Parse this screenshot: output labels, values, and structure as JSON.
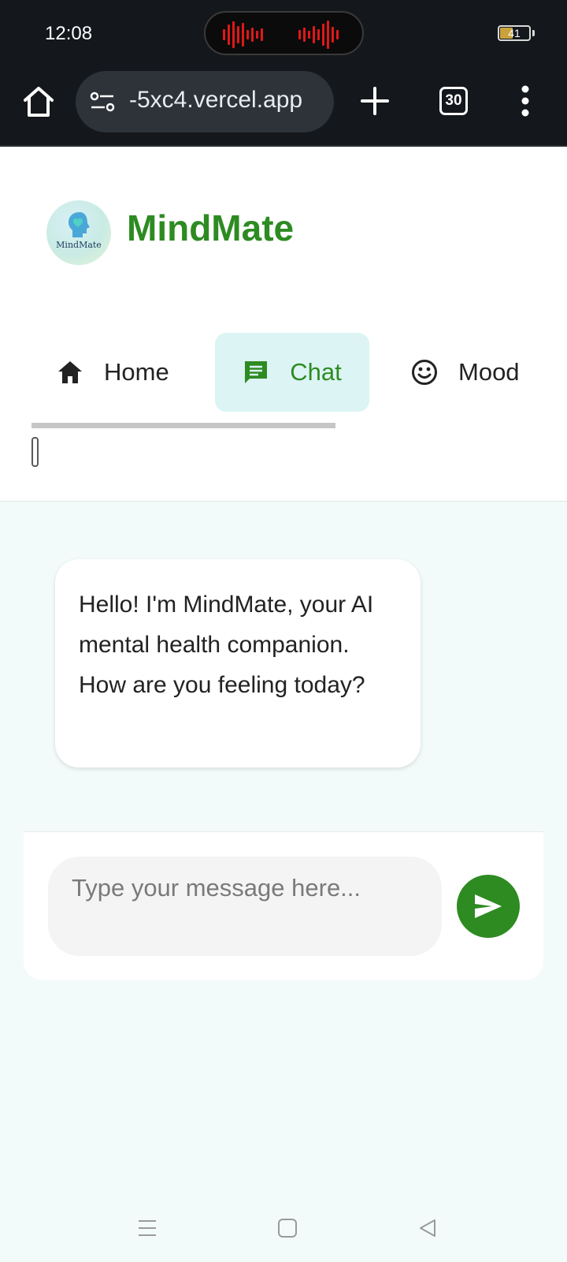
{
  "status_bar": {
    "time": "12:08",
    "battery_percent": 41,
    "battery_label": "41"
  },
  "browser": {
    "url": "-5xc4.vercel.app",
    "tab_count": "30",
    "icons": [
      "home-icon",
      "site-settings-icon",
      "new-tab-plus-icon",
      "tab-switcher-icon",
      "more-vert-icon"
    ]
  },
  "app": {
    "logo_text": "MindMate",
    "brand": "MindMate",
    "brand_color": "#2e8b22"
  },
  "nav": {
    "items": [
      {
        "label": "Home",
        "icon": "home-icon",
        "active": false
      },
      {
        "label": "Chat",
        "icon": "chat-icon",
        "active": true
      },
      {
        "label": "Mood",
        "icon": "smiley-icon",
        "active": false
      }
    ]
  },
  "chat": {
    "messages": [
      {
        "sender": "bot",
        "text": "Hello! I'm MindMate, your AI mental health companion. How are you feeling today?"
      }
    ],
    "input": {
      "value": "",
      "placeholder": "Type your message here..."
    },
    "send_icon": "send-icon"
  },
  "colors": {
    "accent": "#2e8b22",
    "nav_active_bg": "#dcf4f4",
    "page_bg": "#f3fbfa",
    "browser_chrome": "#14171b"
  }
}
